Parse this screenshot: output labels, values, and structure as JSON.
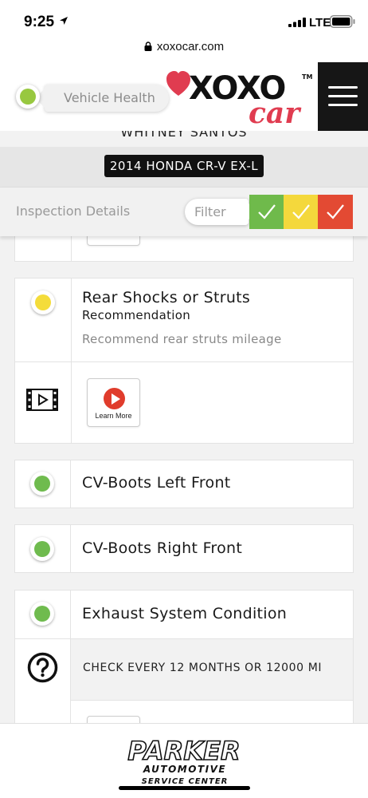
{
  "status_bar": {
    "time": "9:25",
    "network": "LTE"
  },
  "browser": {
    "url": "xoxocar.com"
  },
  "header": {
    "vehicle_health_label": "Vehicle Health",
    "vehicle_health_color": "#98c840",
    "logo_text_top": "XOXO",
    "logo_text_bottom": "car",
    "logo_tm": "TM",
    "brand_red": "#e03c50"
  },
  "owner": {
    "name": "WHITNEY SANTOS"
  },
  "vehicle": {
    "label": "2014 HONDA CR-V EX-L"
  },
  "inspection": {
    "title": "Inspection Details",
    "filter_label": "Filter",
    "filters": [
      {
        "name": "green",
        "color": "#6fba4b"
      },
      {
        "name": "yellow",
        "color": "#f4d83c"
      },
      {
        "name": "red",
        "color": "#e34a33"
      }
    ]
  },
  "items": {
    "rear_shocks": {
      "title": "Rear Shocks or Struts",
      "subtitle": "Recommendation",
      "note": "Recommend rear struts mileage",
      "status_color": "#f4dc3a",
      "learn_more": "Learn More"
    },
    "cv_left": {
      "title": "CV-Boots Left Front",
      "status_color": "#6fbb4e"
    },
    "cv_right": {
      "title": "CV-Boots Right Front",
      "status_color": "#6fbb4e"
    },
    "exhaust": {
      "title": "Exhaust System Condition",
      "status_color": "#6fbb4e",
      "help": "CHECK EVERY 12 MONTHS OR 12000 MI"
    }
  },
  "footer": {
    "logo_line1": "PARKER",
    "logo_line2": "AUTOMOTIVE",
    "logo_line3": "SERVICE CENTER"
  }
}
